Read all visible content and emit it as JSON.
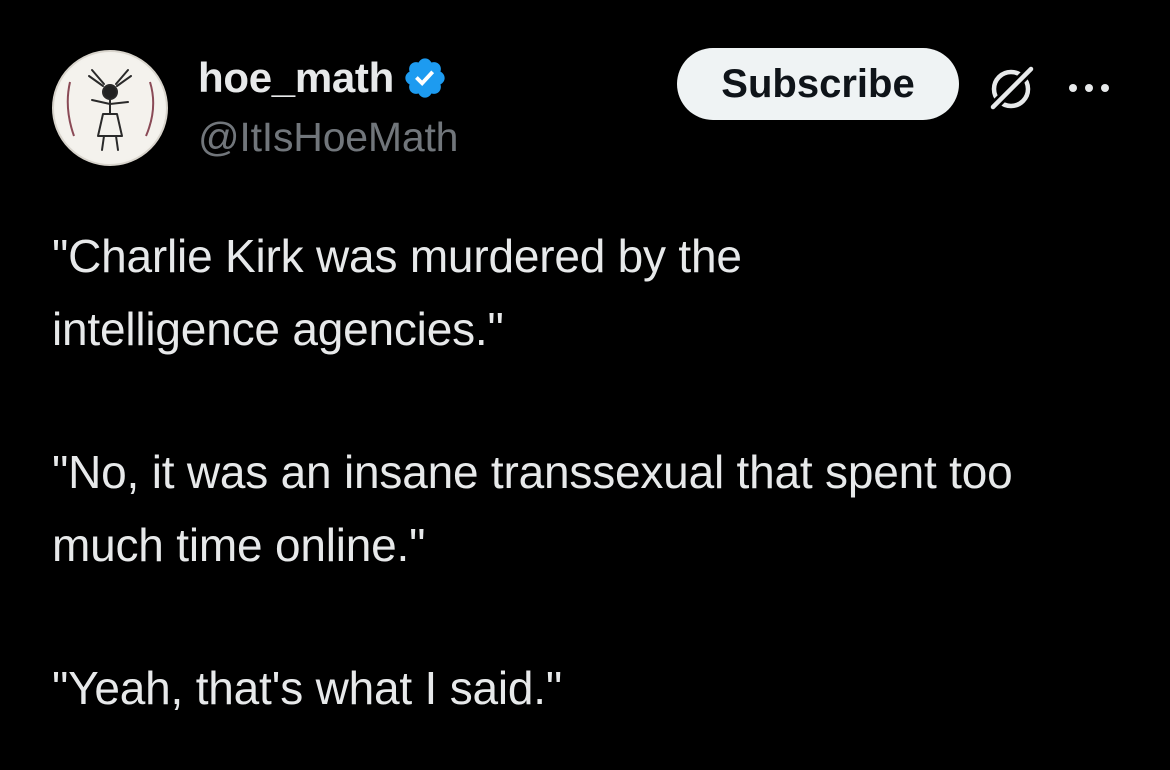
{
  "tweet": {
    "display_name": "hoe_math",
    "handle": "@ItIsHoeMath",
    "subscribe_label": "Subscribe",
    "paragraphs": [
      "\"Charlie Kirk was murdered by the intelligence agencies.\"",
      "\"No, it was an insane transsexual that spent too much time online.\"",
      "\"Yeah, that's what I said.\""
    ]
  },
  "icons": {
    "verified": "verified-badge-icon",
    "grok": "grok-icon",
    "more": "more-icon"
  },
  "colors": {
    "background": "#000000",
    "text_primary": "#e7e9ea",
    "text_secondary": "#71767b",
    "verified_blue": "#1d9bf0",
    "button_bg": "#eff3f4",
    "button_text": "#0f1419"
  }
}
